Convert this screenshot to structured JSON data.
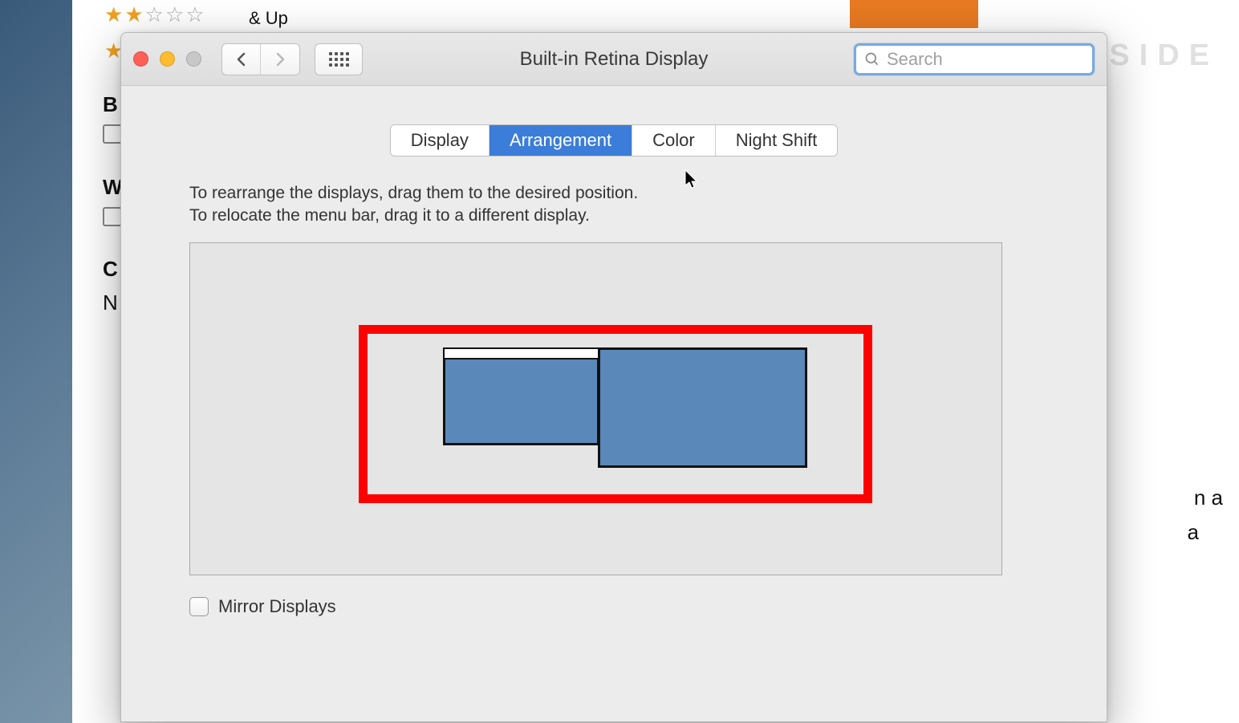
{
  "background": {
    "rating_suffix": "& Up",
    "label_b": "B",
    "label_w": "W",
    "label_c": "C",
    "label_n": "N",
    "right_text_n_a": "n a",
    "right_text_a": "a",
    "watermark": "INSIDE"
  },
  "window": {
    "title": "Built-in Retina Display",
    "search_placeholder": "Search",
    "tabs": {
      "display": "Display",
      "arrangement": "Arrangement",
      "color": "Color",
      "night_shift": "Night Shift"
    },
    "instructions": {
      "line1": "To rearrange the displays, drag them to the desired position.",
      "line2": "To relocate the menu bar, drag it to a different display."
    },
    "mirror_label": "Mirror Displays"
  }
}
